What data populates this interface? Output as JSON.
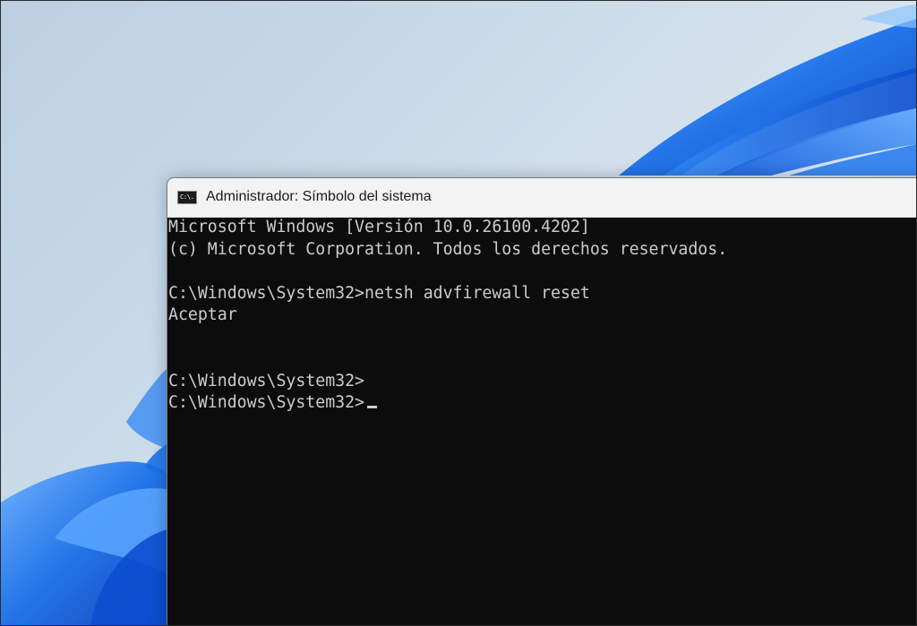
{
  "window": {
    "title": "Administrador: Símbolo del sistema",
    "icon": "cmd-icon",
    "icon_text": "C:\\."
  },
  "console": {
    "lines": [
      "Microsoft Windows [Versión 10.0.26100.4202]",
      "(c) Microsoft Corporation. Todos los derechos reservados.",
      "",
      "C:\\Windows\\System32>netsh advfirewall reset",
      "Aceptar",
      "",
      "",
      "C:\\Windows\\System32>",
      "C:\\Windows\\System32>"
    ]
  },
  "colors": {
    "console_bg": "#0c0c0c",
    "console_text": "#cccccc",
    "titlebar_bg": "#f3f3f3",
    "wallpaper_blue": "#1a6fe8"
  }
}
